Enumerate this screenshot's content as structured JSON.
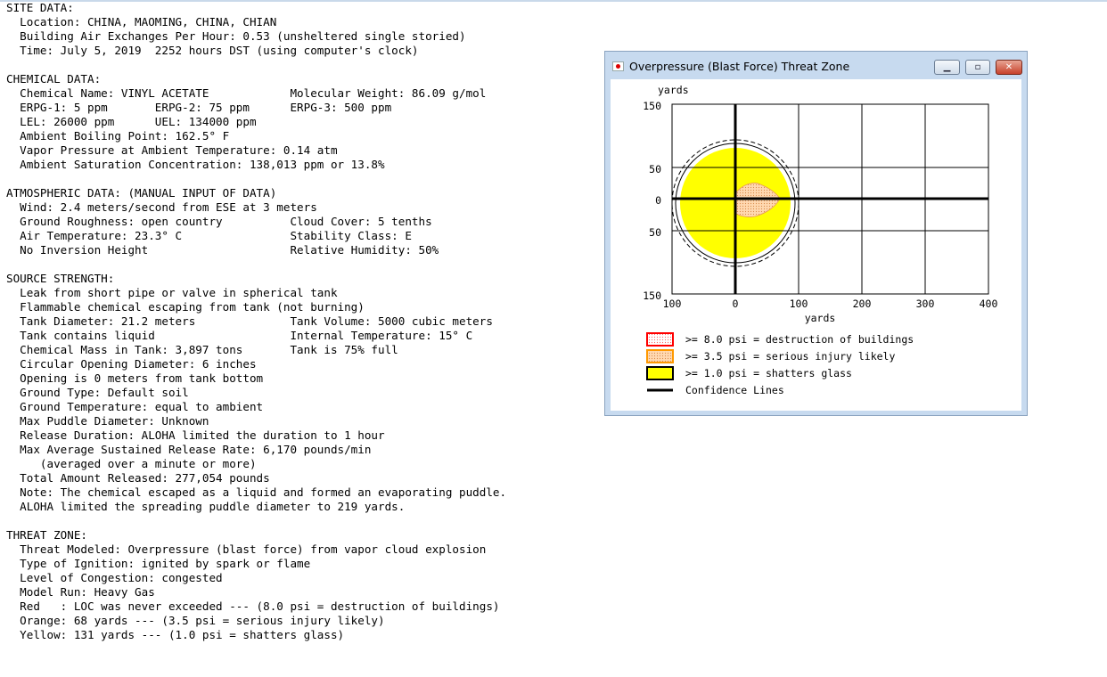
{
  "report": {
    "lines": [
      "SITE DATA:",
      "  Location: CHINA, MAOMING, CHINA, CHIAN",
      "  Building Air Exchanges Per Hour: 0.53 (unsheltered single storied)",
      "  Time: July 5, 2019  2252 hours DST (using computer's clock)",
      "",
      "CHEMICAL DATA:",
      "  Chemical Name: VINYL ACETATE            Molecular Weight: 86.09 g/mol",
      "  ERPG-1: 5 ppm       ERPG-2: 75 ppm      ERPG-3: 500 ppm",
      "  LEL: 26000 ppm      UEL: 134000 ppm",
      "  Ambient Boiling Point: 162.5° F",
      "  Vapor Pressure at Ambient Temperature: 0.14 atm",
      "  Ambient Saturation Concentration: 138,013 ppm or 13.8%",
      "",
      "ATMOSPHERIC DATA: (MANUAL INPUT OF DATA)",
      "  Wind: 2.4 meters/second from ESE at 3 meters",
      "  Ground Roughness: open country          Cloud Cover: 5 tenths",
      "  Air Temperature: 23.3° C                Stability Class: E",
      "  No Inversion Height                     Relative Humidity: 50%",
      "",
      "SOURCE STRENGTH:",
      "  Leak from short pipe or valve in spherical tank",
      "  Flammable chemical escaping from tank (not burning)",
      "  Tank Diameter: 21.2 meters              Tank Volume: 5000 cubic meters",
      "  Tank contains liquid                    Internal Temperature: 15° C",
      "  Chemical Mass in Tank: 3,897 tons       Tank is 75% full",
      "  Circular Opening Diameter: 6 inches",
      "  Opening is 0 meters from tank bottom",
      "  Ground Type: Default soil",
      "  Ground Temperature: equal to ambient",
      "  Max Puddle Diameter: Unknown",
      "  Release Duration: ALOHA limited the duration to 1 hour",
      "  Max Average Sustained Release Rate: 6,170 pounds/min",
      "     (averaged over a minute or more)",
      "  Total Amount Released: 277,054 pounds",
      "  Note: The chemical escaped as a liquid and formed an evaporating puddle.",
      "  ALOHA limited the spreading puddle diameter to 219 yards.",
      "",
      "THREAT ZONE:",
      "  Threat Modeled: Overpressure (blast force) from vapor cloud explosion",
      "  Type of Ignition: ignited by spark or flame",
      "  Level of Congestion: congested",
      "  Model Run: Heavy Gas",
      "  Red   : LOC was never exceeded --- (8.0 psi = destruction of buildings)",
      "  Orange: 68 yards --- (3.5 psi = serious injury likely)",
      "  Yellow: 131 yards --- (1.0 psi = shatters glass)"
    ]
  },
  "window": {
    "title": "Overpressure (Blast Force) Threat Zone",
    "minimize_glyph": "▁",
    "maximize_glyph": "▫",
    "close_glyph": "✕"
  },
  "threat_plot": {
    "y_unit": "yards",
    "x_unit": "yards",
    "x_ticks": [
      "100",
      "0",
      "100",
      "200",
      "300",
      "400"
    ],
    "y_ticks": [
      "150",
      "50",
      "0",
      "50",
      "150"
    ],
    "legend": [
      {
        "label": ">= 8.0 psi = destruction of buildings",
        "swatch_color": "#ffffff",
        "border_color": "#ff0000"
      },
      {
        "label": ">= 3.5 psi = serious injury likely",
        "swatch_color": "#ffd9a8",
        "border_color": "#ff9900"
      },
      {
        "label": ">= 1.0 psi = shatters glass",
        "swatch_color": "#ffff00",
        "border_color": "#000000"
      },
      {
        "label": "Confidence Lines",
        "swatch_color": "#000000"
      }
    ],
    "zones": {
      "yellow_radius_yards": 131,
      "orange_radius_yards": 68
    },
    "colors": {
      "yellow": "#ffff00",
      "orange": "#ffd2a0",
      "grid": "#000000"
    }
  }
}
